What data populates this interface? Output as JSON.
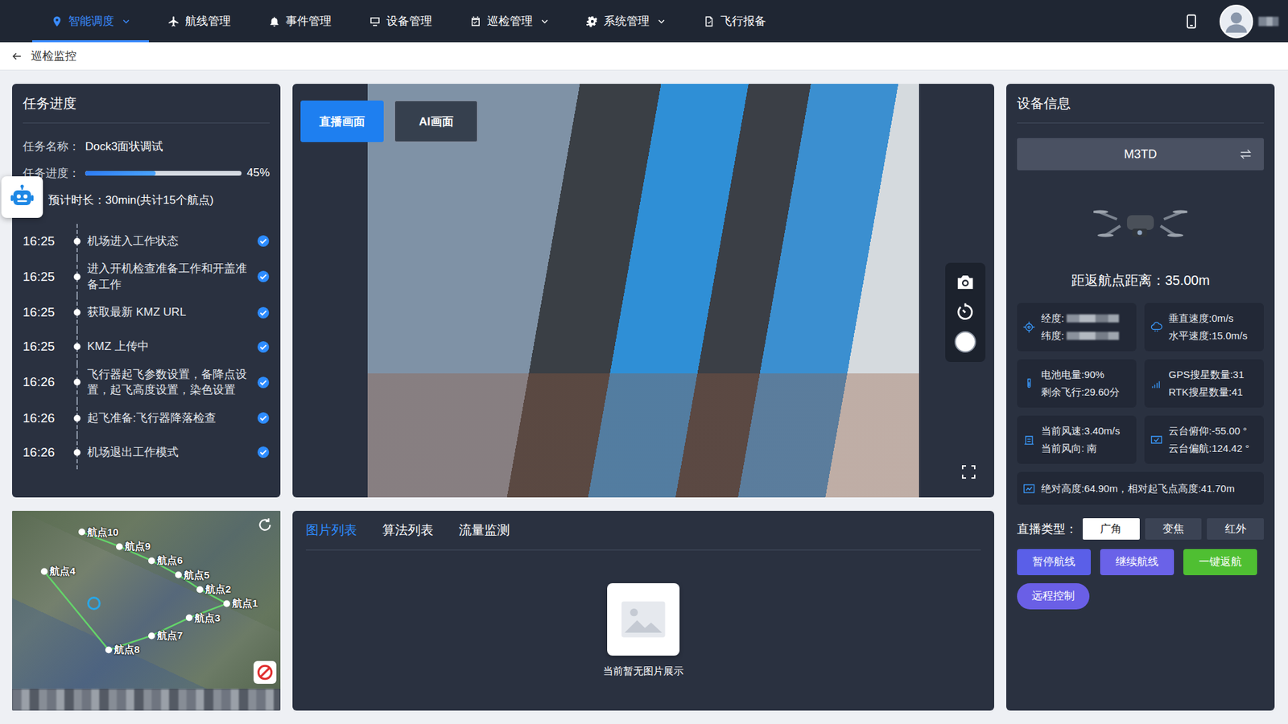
{
  "nav": {
    "items": [
      {
        "label": "智能调度",
        "selected": true,
        "dropdown": true
      },
      {
        "label": "航线管理",
        "selected": false,
        "dropdown": false
      },
      {
        "label": "事件管理",
        "selected": false,
        "dropdown": false
      },
      {
        "label": "设备管理",
        "selected": false,
        "dropdown": false
      },
      {
        "label": "巡检管理",
        "selected": false,
        "dropdown": true
      },
      {
        "label": "系统管理",
        "selected": false,
        "dropdown": true
      },
      {
        "label": "飞行报备",
        "selected": false,
        "dropdown": false
      }
    ],
    "user": {
      "name_redacted": true
    }
  },
  "breadcrumb": {
    "title": "巡检监控"
  },
  "task": {
    "title": "任务进度",
    "name_label": "任务名称：",
    "name": "Dock3面状调试",
    "progress_label": "任务进度：",
    "level": 0.45,
    "progress_text": "45%",
    "duration": "预计时长：30min(共计15个航点)",
    "steps": [
      {
        "time": "16:25",
        "text": "机场进入工作状态",
        "done": true
      },
      {
        "time": "16:25",
        "text": "进入开机检查准备工作和开盖准备工作",
        "done": true
      },
      {
        "time": "16:25",
        "text": "获取最新 KMZ URL",
        "done": true
      },
      {
        "time": "16:25",
        "text": "KMZ 上传中",
        "done": true
      },
      {
        "time": "16:26",
        "text": "飞行器起飞参数设置，备降点设置，起飞高度设置，染色设置",
        "done": true
      },
      {
        "time": "16:26",
        "text": "起飞准备:飞行器降落检查",
        "done": true
      },
      {
        "time": "16:26",
        "text": "机场退出工作模式",
        "done": true
      }
    ]
  },
  "map": {
    "waypoints": [
      "航点1",
      "航点2",
      "航点3",
      "航点4",
      "航点5",
      "航点6",
      "航点7",
      "航点8",
      "航点9",
      "航点10"
    ],
    "attribution_redacted": true
  },
  "video": {
    "modes": [
      {
        "label": "直播画面",
        "selected": true
      },
      {
        "label": "AI画面",
        "selected": false
      }
    ]
  },
  "media": {
    "tabs": [
      {
        "label": "图片列表",
        "selected": true
      },
      {
        "label": "算法列表",
        "selected": false
      },
      {
        "label": "流量监测",
        "selected": false
      }
    ],
    "empty_text": "当前暂无图片展示"
  },
  "device": {
    "title": "设备信息",
    "model": "M3TD",
    "distance": "距返航点距离：35.00m",
    "cards": [
      {
        "lines": [
          {
            "text": "经度:",
            "redacted": true
          },
          {
            "text": "纬度:",
            "redacted": true
          }
        ]
      },
      {
        "lines": [
          {
            "text": "垂直速度:0m/s",
            "redacted": false
          },
          {
            "text": "水平速度:15.0m/s",
            "redacted": false
          }
        ]
      },
      {
        "lines": [
          {
            "text": "电池电量:90%",
            "redacted": false
          },
          {
            "text": "剩余飞行:29.60分",
            "redacted": false
          }
        ]
      },
      {
        "lines": [
          {
            "text": "GPS搜星数量:31",
            "redacted": false
          },
          {
            "text": "RTK搜星数量:41",
            "redacted": false
          }
        ]
      },
      {
        "lines": [
          {
            "text": "当前风速:3.40m/s",
            "redacted": false
          },
          {
            "text": "当前风向: 南",
            "redacted": false
          }
        ]
      },
      {
        "lines": [
          {
            "text": "云台俯仰:-55.00 °",
            "redacted": false
          },
          {
            "text": "云台偏航:124.42 °",
            "redacted": false
          }
        ]
      }
    ],
    "altitude": "绝对高度:64.90m，相对起飞点高度:41.70m",
    "live_label": "直播类型：",
    "live_types": [
      {
        "label": "广角",
        "selected": true
      },
      {
        "label": "变焦",
        "selected": false
      },
      {
        "label": "红外",
        "selected": false
      }
    ],
    "actions": [
      {
        "label": "暂停航线",
        "color": "#5a5fe8",
        "kind": "button"
      },
      {
        "label": "继续航线",
        "color": "#6a62e8",
        "kind": "button"
      },
      {
        "label": "一键返航",
        "color": "#4fbf32",
        "kind": "button"
      },
      {
        "label": "远程控制",
        "color": "#6a5fe6",
        "kind": "pill"
      }
    ]
  }
}
